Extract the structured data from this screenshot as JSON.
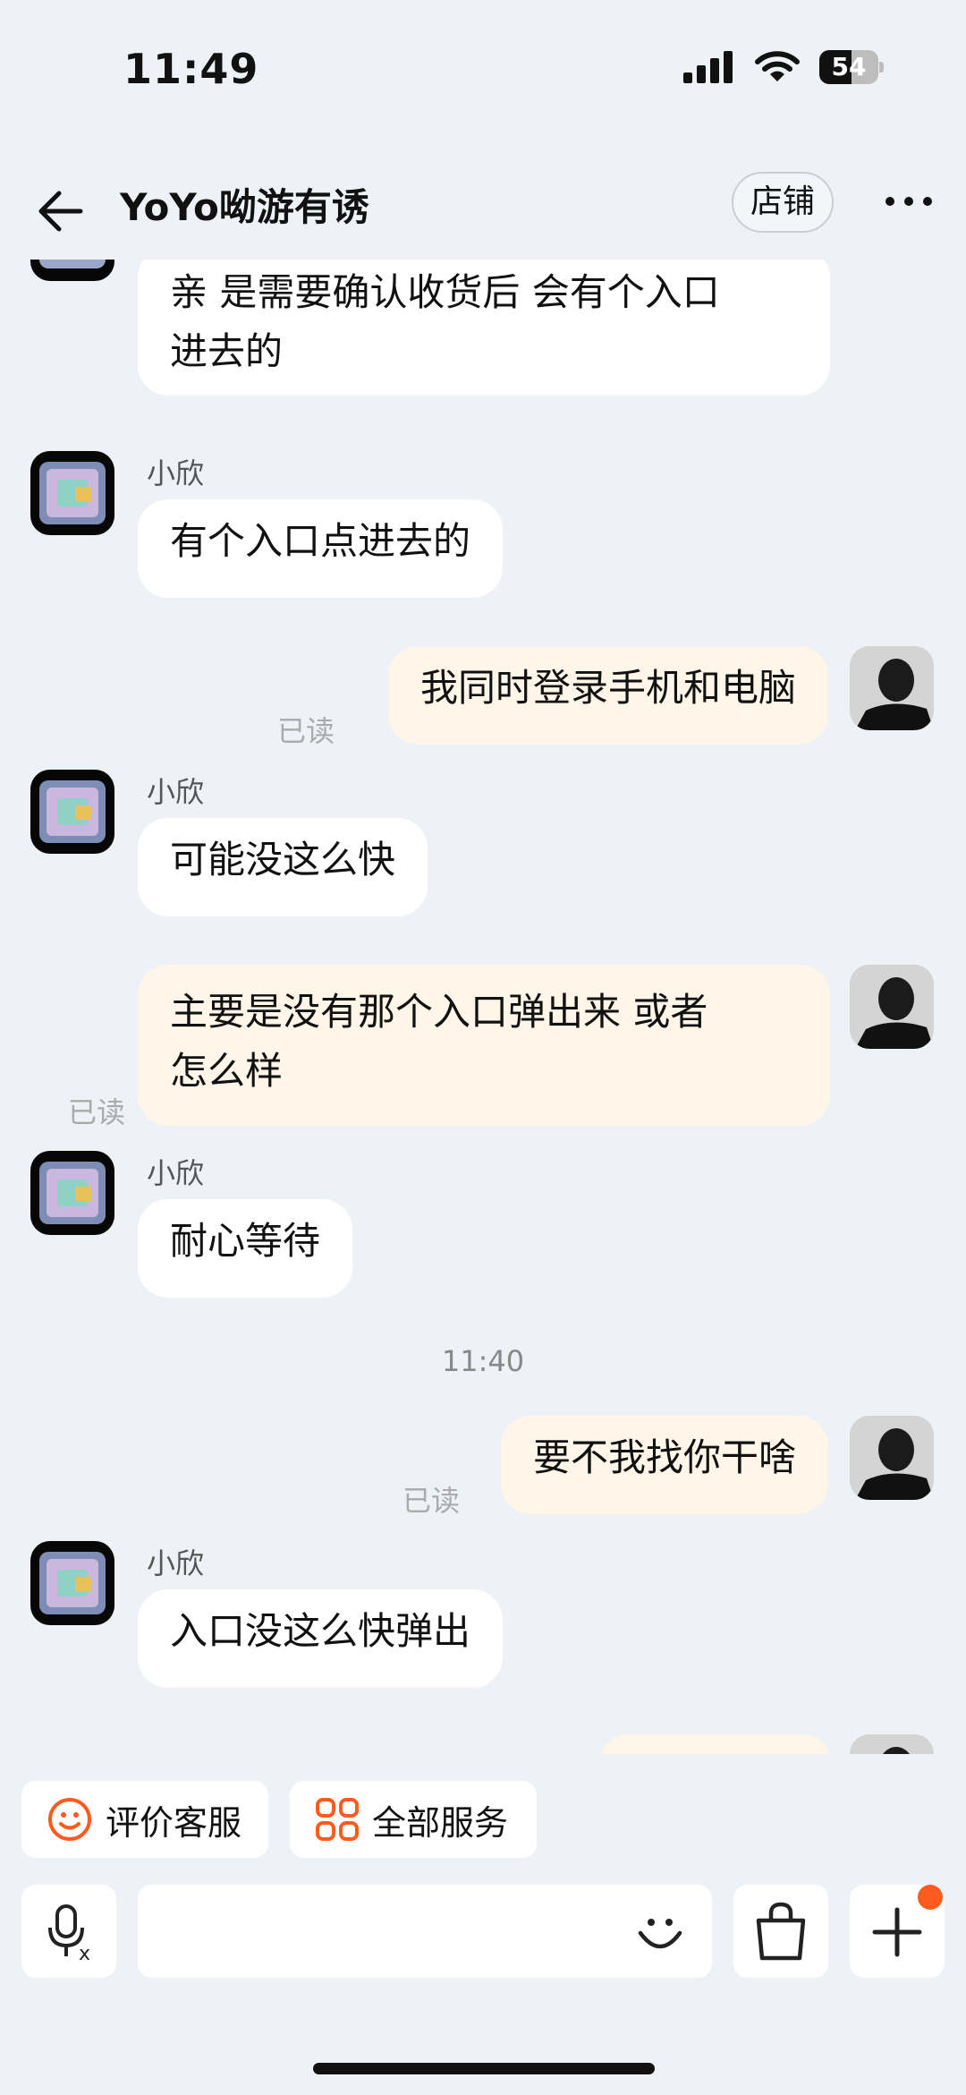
{
  "status_bar": {
    "time": "11:49",
    "battery": "54",
    "battery_level": 0.54
  },
  "nav": {
    "title": "YoYo呦游有诱",
    "shop_label": "店铺"
  },
  "messages": [
    {
      "text_line1": "亲 是需要确认收货后 会有个入口",
      "text_line2": "进去的"
    },
    {
      "sender": "小欣",
      "text": "有个入口点进去的"
    },
    {
      "text": "我同时登录手机和电脑",
      "status": "已读"
    },
    {
      "sender": "小欣",
      "text": "可能没这么快"
    },
    {
      "text_line1": "主要是没有那个入口弹出来 或者",
      "text_line2": "怎么样",
      "status": "已读"
    },
    {
      "sender": "小欣",
      "text": "耐心等待"
    },
    {
      "time": "11:40"
    },
    {
      "text": "要不我找你干啥",
      "status": "已读"
    },
    {
      "sender": "小欣",
      "text": "入口没这么快弹出"
    }
  ],
  "quick_actions": [
    {
      "label": "评价客服",
      "icon": "smile-icon"
    },
    {
      "label": "全部服务",
      "icon": "grid-icon"
    }
  ],
  "icons": {
    "back": "back-arrow-icon",
    "more": "more-icon",
    "voice": "voice-icon",
    "emoji": "emoji-icon",
    "bag": "shopping-bag-icon",
    "plus": "plus-icon"
  },
  "colors": {
    "accent": "#ff5a1f",
    "outgoing_bubble": "#fff5e8",
    "background": "#eef2f6"
  }
}
